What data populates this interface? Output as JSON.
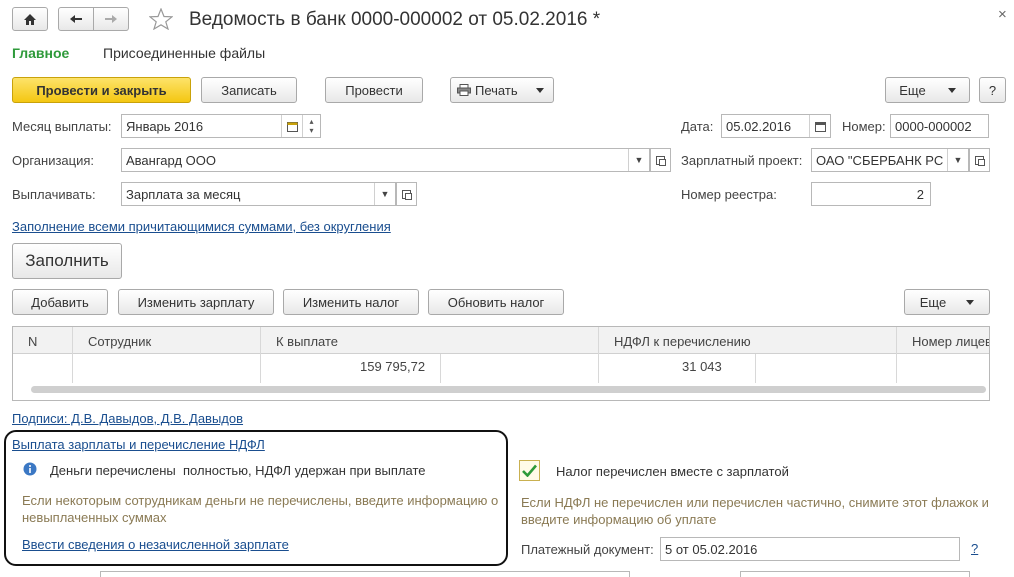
{
  "window": {
    "title": "Ведомость в банк 0000-000002 от 05.02.2016 *"
  },
  "nav": {
    "home_icon": "home-icon",
    "back_icon": "arrow-left-icon",
    "forward_icon": "arrow-right-icon",
    "star_icon": "star-icon",
    "close_glyph": "×"
  },
  "tabs": [
    {
      "label": "Главное",
      "active": true
    },
    {
      "label": "Присоединенные файлы",
      "active": false
    }
  ],
  "toolbar": {
    "post_close": "Провести и закрыть",
    "save": "Записать",
    "post": "Провести",
    "print": "Печать",
    "more": "Еще",
    "help": "?"
  },
  "form": {
    "month_label": "Месяц выплаты:",
    "month_value": "Январь 2016",
    "date_label": "Дата:",
    "date_value": "05.02.2016",
    "number_label": "Номер:",
    "number_value": "0000-000002",
    "org_label": "Организация:",
    "org_value": "Авангард ООО",
    "project_label": "Зарплатный проект:",
    "project_value": "ОАО \"СБЕРБАНК РС",
    "pay_label": "Выплачивать:",
    "pay_value": "Зарплата за месяц",
    "registry_label": "Номер реестра:",
    "registry_value": "2"
  },
  "fill_link": "Заполнение всеми причитающимися суммами, без округления",
  "fill_button": "Заполнить",
  "table_toolbar": {
    "add": "Добавить",
    "edit_salary": "Изменить зарплату",
    "edit_tax": "Изменить налог",
    "update_tax": "Обновить налог",
    "more": "Еще"
  },
  "table": {
    "columns": [
      "N",
      "Сотрудник",
      "К выплате",
      "НДФЛ к перечислению",
      "Номер лицев"
    ],
    "totals": {
      "to_pay": "159 795,72",
      "tax": "31 043"
    }
  },
  "signatures_link": "Подписи: Д.В. Давыдов, Д.В. Давыдов",
  "payment": {
    "link": "Выплата зарплаты и перечисление НДФЛ",
    "info_icon": "info-icon",
    "info_text": "Деньги перечислены  полностью, НДФЛ удержан при выплате",
    "hint": "Если некоторым сотрудникам деньги не перечислены, введите информацию о невыплаченных суммах",
    "unpaid_link": "Ввести сведения о незачисленной зарплате",
    "tax_checkbox_label": "Налог перечислен вместе с зарплатой",
    "tax_checkbox_checked": true,
    "tax_hint": "Если НДФЛ не перечислен или перечислен частично, снимите этот флажок и введите информацию об уплате",
    "payment_doc_label": "Платежный документ:",
    "payment_doc_value": "5 от 05.02.2016",
    "payment_doc_help": "?"
  },
  "colors": {
    "accent_green": "#2e9a3a",
    "primary_button": "#f4c712",
    "link": "#1a4e8f",
    "hint": "#8a7a54"
  }
}
